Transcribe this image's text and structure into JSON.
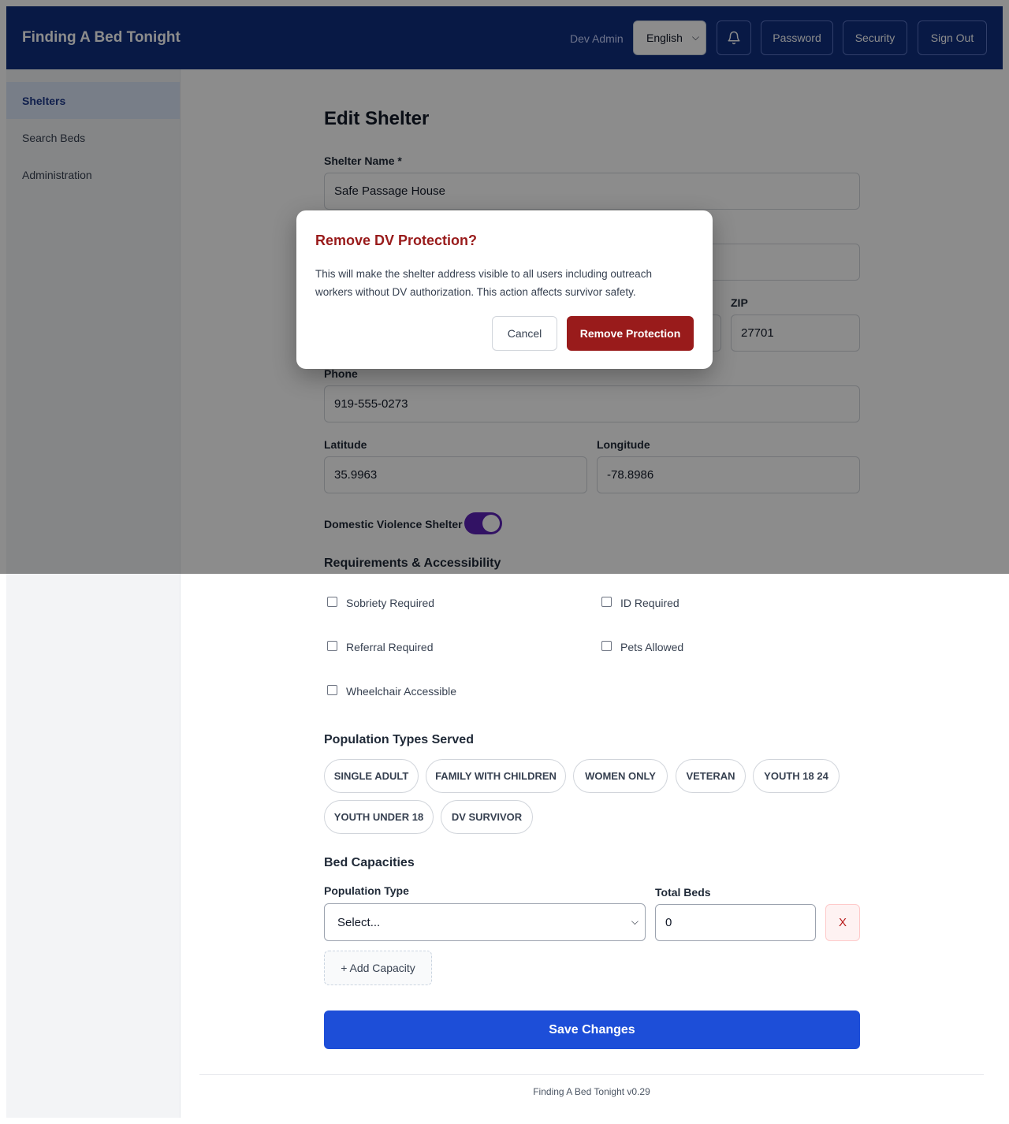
{
  "header": {
    "brand": "Finding A Bed Tonight",
    "user_name": "Dev Admin",
    "language": "English",
    "password_label": "Password",
    "security_label": "Security",
    "signout_label": "Sign Out"
  },
  "sidebar": {
    "items": [
      {
        "label": "Shelters",
        "active": true
      },
      {
        "label": "Search Beds",
        "active": false
      },
      {
        "label": "Administration",
        "active": false
      }
    ]
  },
  "form": {
    "title": "Edit Shelter",
    "shelter_name_label": "Shelter Name *",
    "shelter_name_value": "Safe Passage House",
    "zip_label": "ZIP",
    "zip_value": "27701",
    "phone_label": "Phone",
    "phone_value": "919-555-0273",
    "latitude_label": "Latitude",
    "latitude_value": "35.9963",
    "longitude_label": "Longitude",
    "longitude_value": "-78.8986",
    "dv_label": "Domestic Violence Shelter",
    "dv_enabled": true,
    "requirements_title": "Requirements & Accessibility",
    "requirements": [
      "Sobriety Required",
      "ID Required",
      "Referral Required",
      "Pets Allowed",
      "Wheelchair Accessible"
    ],
    "population_title": "Population Types Served",
    "population_types": [
      "SINGLE ADULT",
      "FAMILY WITH CHILDREN",
      "WOMEN ONLY",
      "VETERAN",
      "YOUTH 18 24",
      "YOUTH UNDER 18",
      "DV SURVIVOR"
    ],
    "bed_title": "Bed Capacities",
    "population_type_label": "Population Type",
    "population_type_value": "Select...",
    "total_beds_label": "Total Beds",
    "total_beds_value": "0",
    "remove_row_label": "X",
    "add_capacity_label": "+ Add Capacity",
    "save_label": "Save Changes"
  },
  "footer": {
    "text": "Finding A Bed Tonight v0.29"
  },
  "modal": {
    "title": "Remove DV Protection?",
    "body": "This will make the shelter address visible to all users including outreach workers without DV authorization. This action affects survivor safety.",
    "cancel_label": "Cancel",
    "confirm_label": "Remove Protection"
  },
  "colors": {
    "header_bg": "#0f2e7e",
    "primary": "#1d4ed8",
    "danger": "#991b1b",
    "toggle_on": "#5b21b6"
  }
}
